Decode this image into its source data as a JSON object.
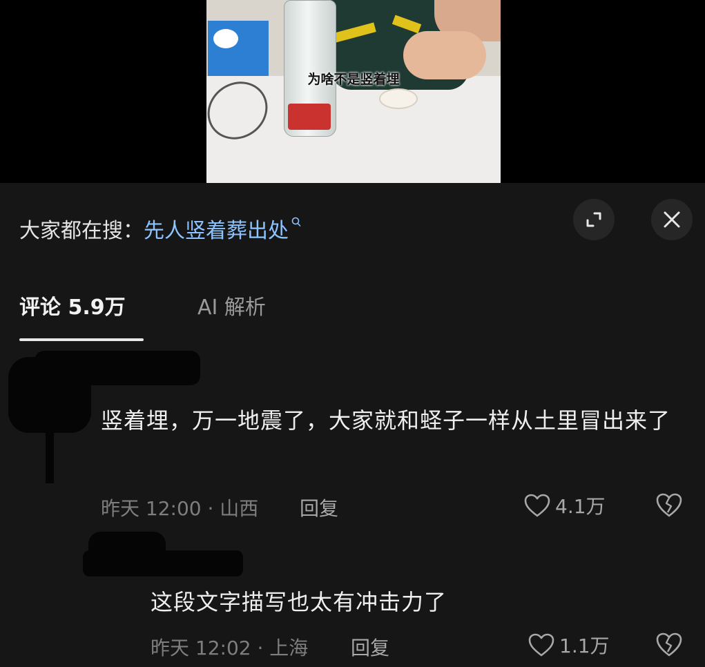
{
  "video": {
    "caption": "为啥不是竖着埋"
  },
  "search": {
    "prefix": "大家都在搜：",
    "term": "先人竖着葬出处",
    "glass_icon": "search-icon"
  },
  "controls": {
    "expand_icon": "expand-icon",
    "close_icon": "close-icon"
  },
  "tabs": {
    "comments_label": "评论 5.9万",
    "ai_label": "AI 解析"
  },
  "comments": [
    {
      "text": "竖着埋，万一地震了，大家就和蛏子一样从土里冒出来了",
      "meta": "昨天 12:00 · 山西",
      "reply_label": "回复",
      "likes": "4.1万"
    },
    {
      "text": "这段文字描写也太有冲击力了",
      "meta": "昨天 12:02 · 上海",
      "reply_label": "回复",
      "likes": "1.1万"
    }
  ],
  "colors": {
    "background": "#000000",
    "panel": "#161616",
    "search_link": "#8cc4ff",
    "muted_text": "#7e7e7e"
  }
}
